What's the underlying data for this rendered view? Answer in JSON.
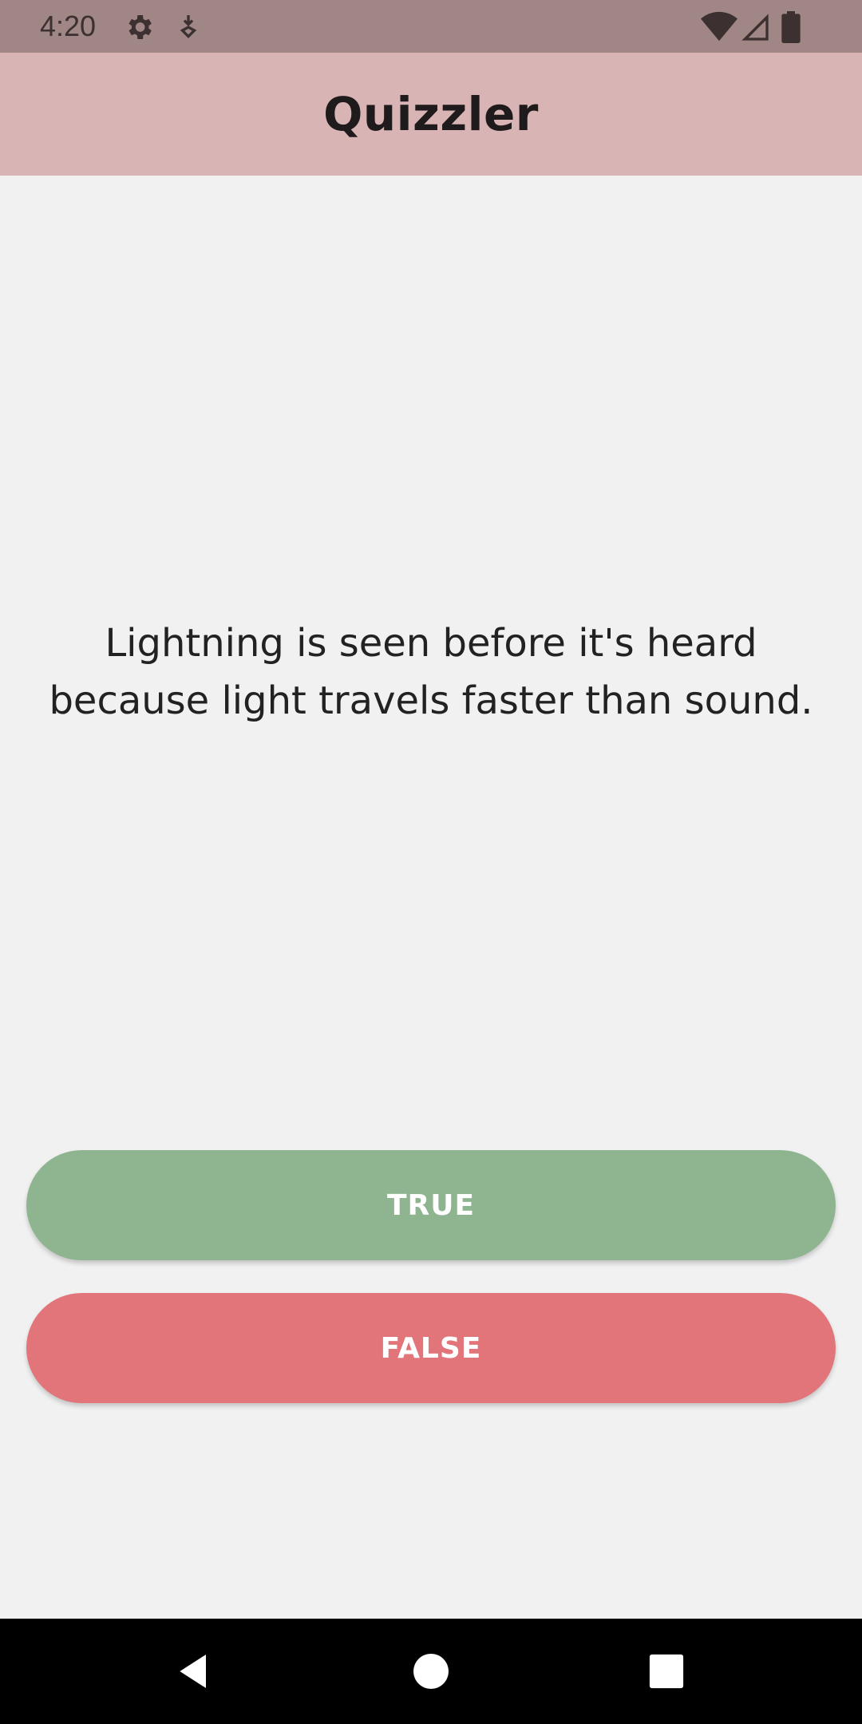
{
  "status_bar": {
    "time": "4:20",
    "icons": [
      "gear-icon",
      "download-icon",
      "wifi-icon",
      "signal-icon",
      "battery-icon"
    ]
  },
  "app_bar": {
    "title": "Quizzler"
  },
  "question": {
    "text": "Lightning is seen before it's heard because light travels faster than sound."
  },
  "buttons": {
    "true_label": "TRUE",
    "false_label": "FALSE",
    "true_color": "#8fb490",
    "false_color": "#e27579"
  },
  "nav_bar": {
    "icons": [
      "back-icon",
      "home-icon",
      "recents-icon"
    ]
  },
  "colors": {
    "status_bar": "#a18686",
    "app_bar": "#d8b4b4",
    "background": "#f1f1f1"
  }
}
